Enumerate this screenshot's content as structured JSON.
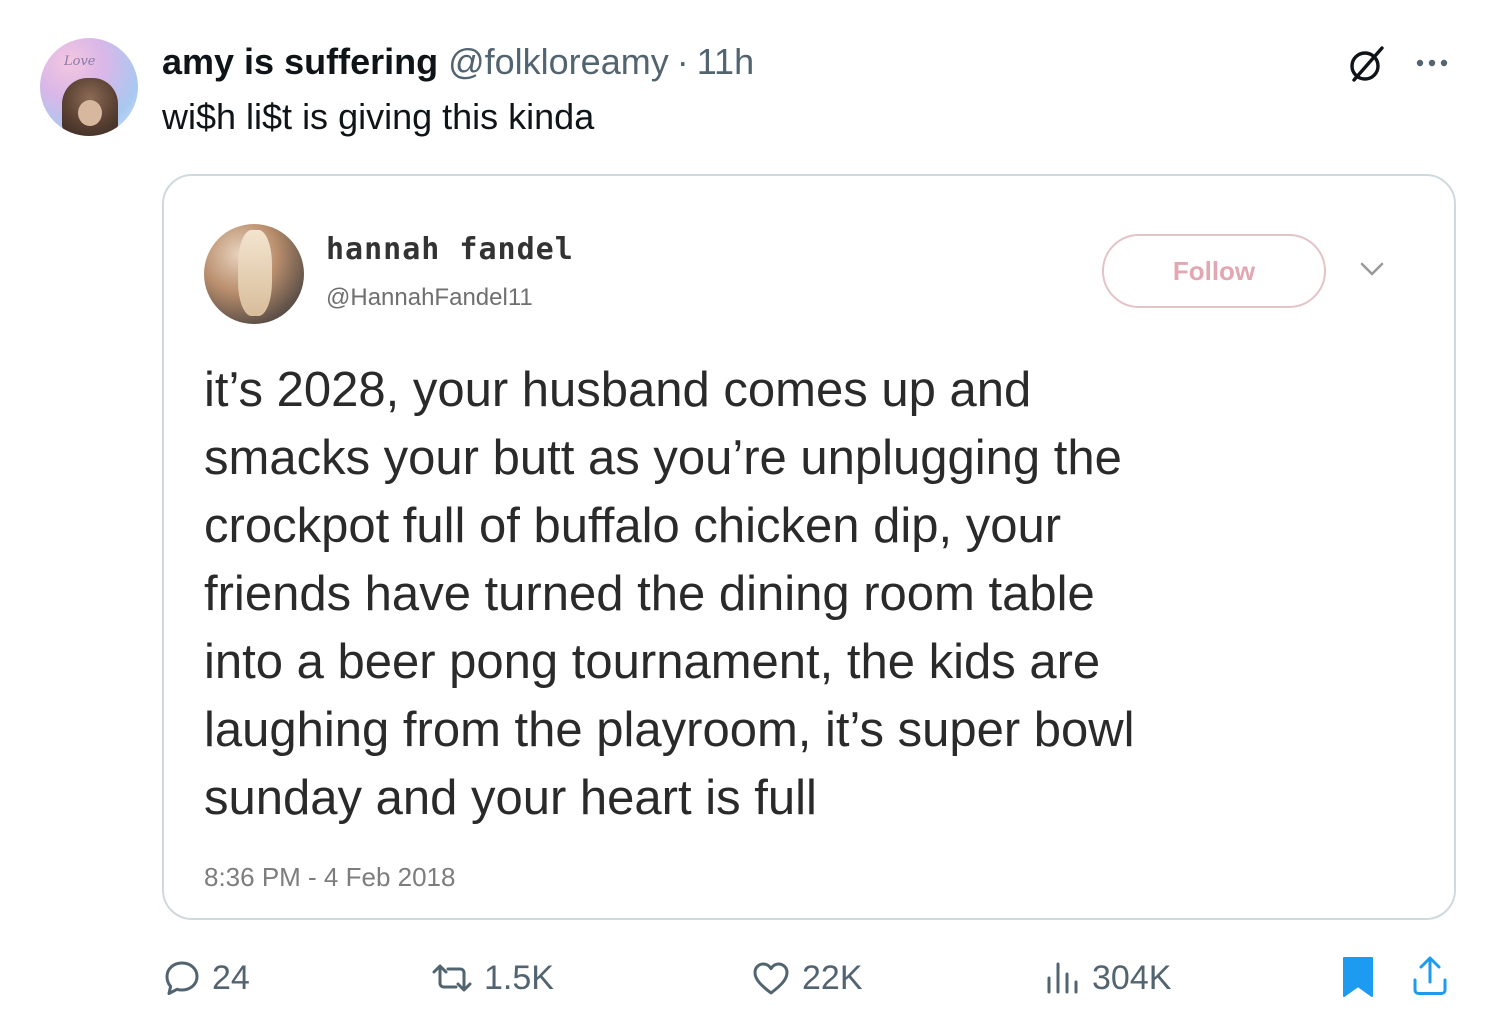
{
  "post": {
    "display_name": "amy is suffering",
    "handle": "@folkloreamy",
    "separator": "·",
    "time": "11h",
    "text": "wi$h li$t is giving this kinda",
    "avatar_script": "Love"
  },
  "quoted": {
    "name": "hannah fandel",
    "handle": "@HannahFandel11",
    "follow_label": "Follow",
    "body": "it’s 2028, your husband comes up and\nsmacks your butt as you’re unplugging the\ncrockpot full of buffalo chicken dip, your\nfriends have turned the dining room table\ninto a beer pong tournament, the kids are\nlaughing from the playroom, it’s super bowl\nsunday and your heart is full",
    "date": "8:36 PM - 4 Feb 2018"
  },
  "actions": {
    "replies": "24",
    "reposts": "1.5K",
    "likes": "22K",
    "views": "304K"
  },
  "colors": {
    "text": "#0f1419",
    "secondary": "#536471",
    "border": "#cfd9de",
    "bookmark_active": "#1d9bf0",
    "follow_text": "#e2a7b2"
  },
  "icons": {
    "grok": "grok-icon",
    "more": "more-icon",
    "chevron": "chevron-down-icon",
    "reply": "reply-icon",
    "repost": "repost-icon",
    "like": "heart-icon",
    "views": "views-icon",
    "bookmark": "bookmark-icon",
    "share": "share-icon"
  }
}
